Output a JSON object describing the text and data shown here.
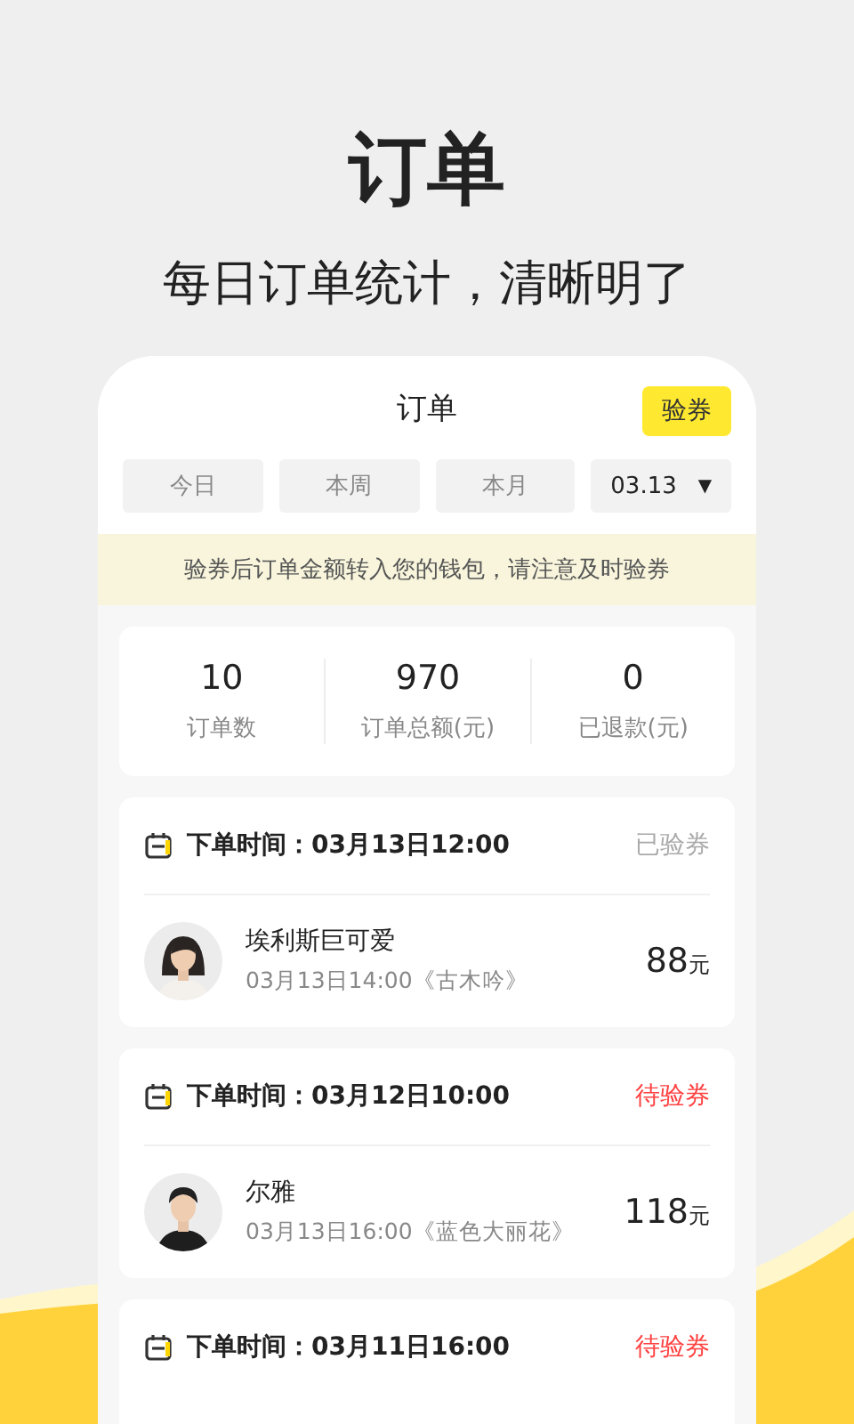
{
  "headline": "订单",
  "subtitle": "每日订单统计，清晰明了",
  "screen": {
    "title": "订单",
    "action": "验券",
    "tabs": [
      {
        "label": "今日",
        "selected": false
      },
      {
        "label": "本周",
        "selected": false
      },
      {
        "label": "本月",
        "selected": false
      }
    ],
    "date_picker": {
      "value": "03.13",
      "caret": "▼"
    },
    "notice": "验券后订单金额转入您的钱包，请注意及时验券",
    "stats": [
      {
        "value": "10",
        "label": "订单数"
      },
      {
        "value": "970",
        "label": "订单总额(元)"
      },
      {
        "value": "0",
        "label": "已退款(元)"
      }
    ],
    "orders": [
      {
        "time": "下单时间：03月13日12:00",
        "status": "已验券",
        "verified": true,
        "customer": {
          "kind": "picture",
          "name": "埃利斯巨可爱",
          "detail": "03月13日14:00《古木吟》"
        },
        "amount": "88",
        "unit": "元"
      },
      {
        "time": "下单时间：03月12日10:00",
        "status": "待验券",
        "verified": false,
        "customer": {
          "kind": "picture",
          "name": "尔雅",
          "detail": "03月13日16:00《蓝色大丽花》"
        },
        "amount": "118",
        "unit": "元"
      },
      {
        "time": "下单时间：03月11日16:00",
        "status": "待验券",
        "verified": false
      }
    ]
  }
}
